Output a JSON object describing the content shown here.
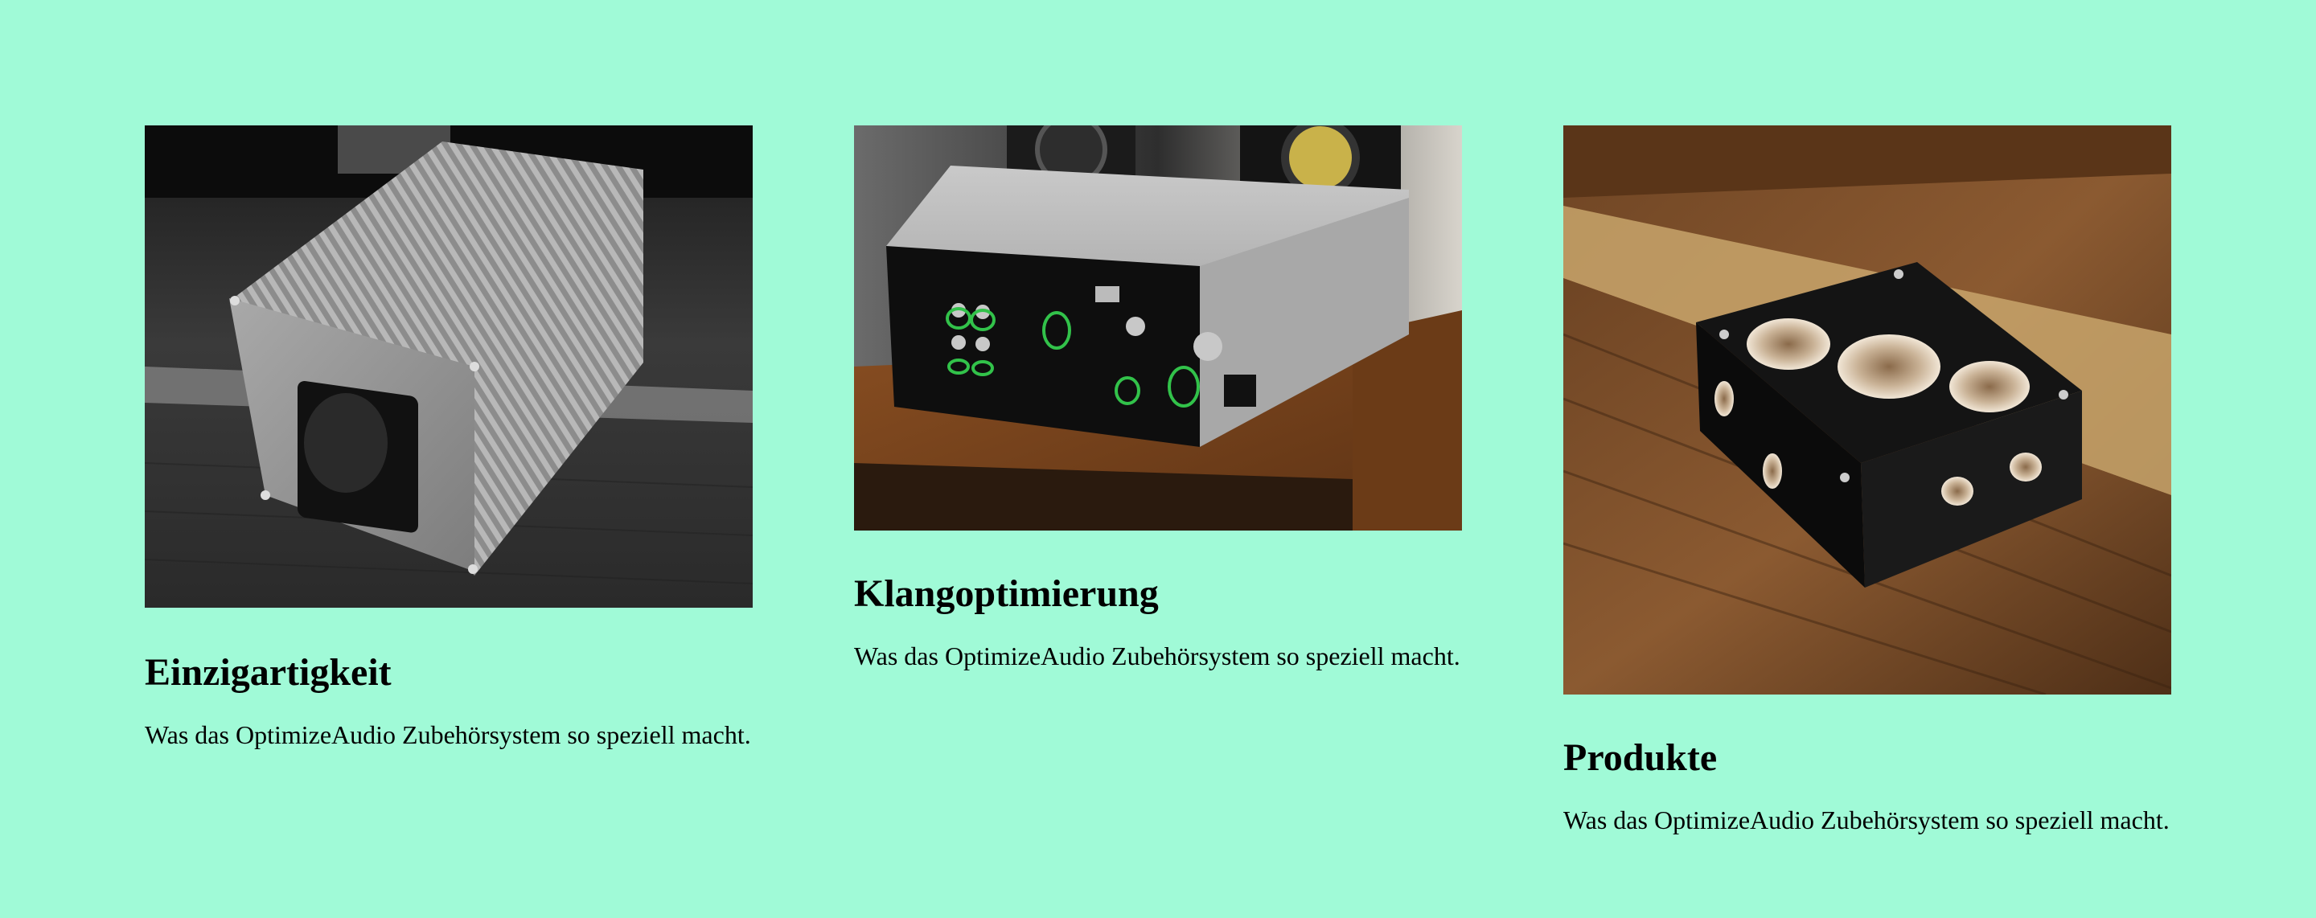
{
  "page": {
    "background": "#a0fad7"
  },
  "cards": [
    {
      "title": "Einzigartigkeit",
      "text": "Was das OptimizeAudio Zubehörsystem so speziell macht.",
      "image": "grayscale photo of an aluminium power distribution box with a socket"
    },
    {
      "title": "Klangoptimierung",
      "text": "Was das OptimizeAudio Zubehörsystem so speziell macht.",
      "image": "photo of the back panel of a silver audio amplifier on a wooden shelf"
    },
    {
      "title": "Produkte",
      "text": "Was das OptimizeAudio Zubehörsystem so speziell macht.",
      "image": "photo of a black wooden cable block with round holes on a wooden surface"
    }
  ]
}
